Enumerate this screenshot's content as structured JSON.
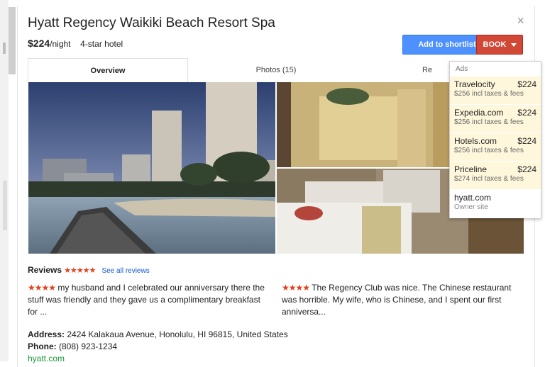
{
  "hotel": {
    "name": "Hyatt Regency Waikiki Beach Resort Spa",
    "price": "$224",
    "per_night": "/night",
    "class": "4-star hotel"
  },
  "actions": {
    "shortlist_label": "Add to shortlist",
    "book_label": "BOOK",
    "close_glyph": "×"
  },
  "tabs": [
    {
      "label": "Overview",
      "active": true
    },
    {
      "label": "Photos (15)",
      "active": false
    },
    {
      "label": "Re",
      "active": false
    }
  ],
  "booking_dropdown": {
    "ads_label": "Ads",
    "providers": [
      {
        "name": "Travelocity",
        "price": "$224",
        "detail": "$256 incl taxes & fees"
      },
      {
        "name": "Expedia.com",
        "price": "$224",
        "detail": "$256 incl taxes & fees"
      },
      {
        "name": "Hotels.com",
        "price": "$224",
        "detail": "$256 incl taxes & fees"
      },
      {
        "name": "Priceline",
        "price": "$224",
        "detail": "$274 incl taxes & fees"
      }
    ],
    "owner": {
      "name": "hyatt.com",
      "detail": "Owner site"
    }
  },
  "reviews": {
    "heading": "Reviews",
    "stars": "★★★★★",
    "see_all": "See all reviews",
    "items": [
      {
        "stars": "★★★★",
        "text": "my husband and I celebrated our anniversary there the stuff was friendly and they gave us a complimentary breakfast for ..."
      },
      {
        "stars": "★★★★",
        "text": "The Regency Club was nice. The Chinese restaurant was horrible. My wife, who is Chinese, and I spent our first anniversa..."
      }
    ]
  },
  "details": {
    "address_label": "Address:",
    "address": "2424 Kalakaua Avenue, Honolulu, HI 96815, United States",
    "phone_label": "Phone:",
    "phone": "(808) 923-1234",
    "website": "hyatt.com"
  },
  "colors": {
    "shortlist_blue": "#4d90fe",
    "book_red": "#d14836",
    "star_red": "#e0401c",
    "ad_highlight": "#fff7dc"
  }
}
